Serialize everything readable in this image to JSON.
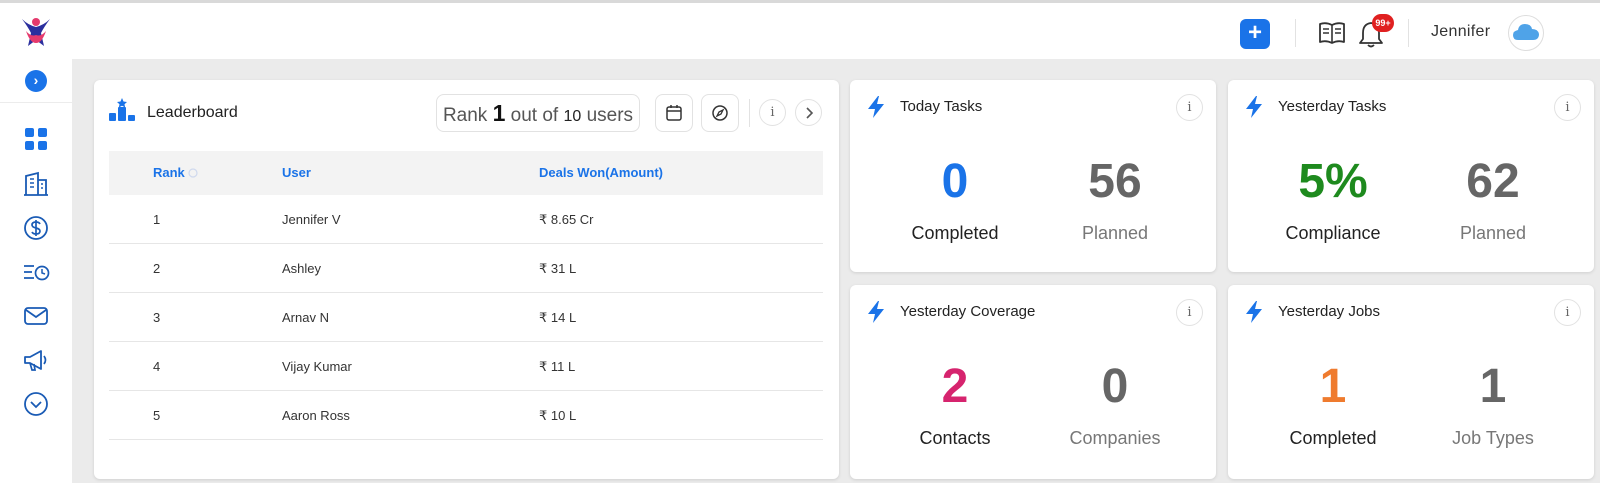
{
  "header": {
    "add_label": "+",
    "notification_count": "99+",
    "user_name": "Jennifer"
  },
  "sidebar": {
    "toggle_label": "›",
    "items": [
      {
        "name": "dashboard-icon"
      },
      {
        "name": "building-icon"
      },
      {
        "name": "dollar-icon"
      },
      {
        "name": "activity-clock-icon"
      },
      {
        "name": "mail-icon"
      },
      {
        "name": "megaphone-icon"
      },
      {
        "name": "chevron-down-circle-icon"
      }
    ]
  },
  "leaderboard": {
    "title": "Leaderboard",
    "rank_prefix": "Rank",
    "rank_value": "1",
    "rank_mid": "out of",
    "rank_total": "10",
    "rank_suffix": "users",
    "info_label": "i",
    "columns": [
      "Rank",
      "User",
      "Deals Won(Amount)"
    ],
    "rows": [
      {
        "rank": "1",
        "user": "Jennifer V",
        "amount": "₹ 8.65 Cr"
      },
      {
        "rank": "2",
        "user": "Ashley",
        "amount": "₹ 31 L"
      },
      {
        "rank": "3",
        "user": "Arnav N",
        "amount": "₹ 14 L"
      },
      {
        "rank": "4",
        "user": "Vijay Kumar",
        "amount": "₹ 11 L"
      },
      {
        "rank": "5",
        "user": "Aaron Ross",
        "amount": "₹ 10 L"
      }
    ]
  },
  "cards": {
    "today_tasks": {
      "title": "Today Tasks",
      "info": "i",
      "primary_value": "0",
      "primary_label": "Completed",
      "secondary_value": "56",
      "secondary_label": "Planned",
      "primary_color": "#1a73e8"
    },
    "yesterday_tasks": {
      "title": "Yesterday Tasks",
      "info": "i",
      "primary_value": "5%",
      "primary_label": "Compliance",
      "secondary_value": "62",
      "secondary_label": "Planned",
      "primary_color": "#1e8a1e"
    },
    "yesterday_coverage": {
      "title": "Yesterday Coverage",
      "info": "i",
      "primary_value": "2",
      "primary_label": "Contacts",
      "secondary_value": "0",
      "secondary_label": "Companies",
      "primary_color": "#d6246e"
    },
    "yesterday_jobs": {
      "title": "Yesterday Jobs",
      "info": "i",
      "primary_value": "1",
      "primary_label": "Completed",
      "secondary_value": "1",
      "secondary_label": "Job Types",
      "primary_color": "#ef7b2e"
    }
  },
  "colors": {
    "accent": "#1a73e8",
    "secondary_value": "#666666",
    "secondary_label": "#777777"
  }
}
